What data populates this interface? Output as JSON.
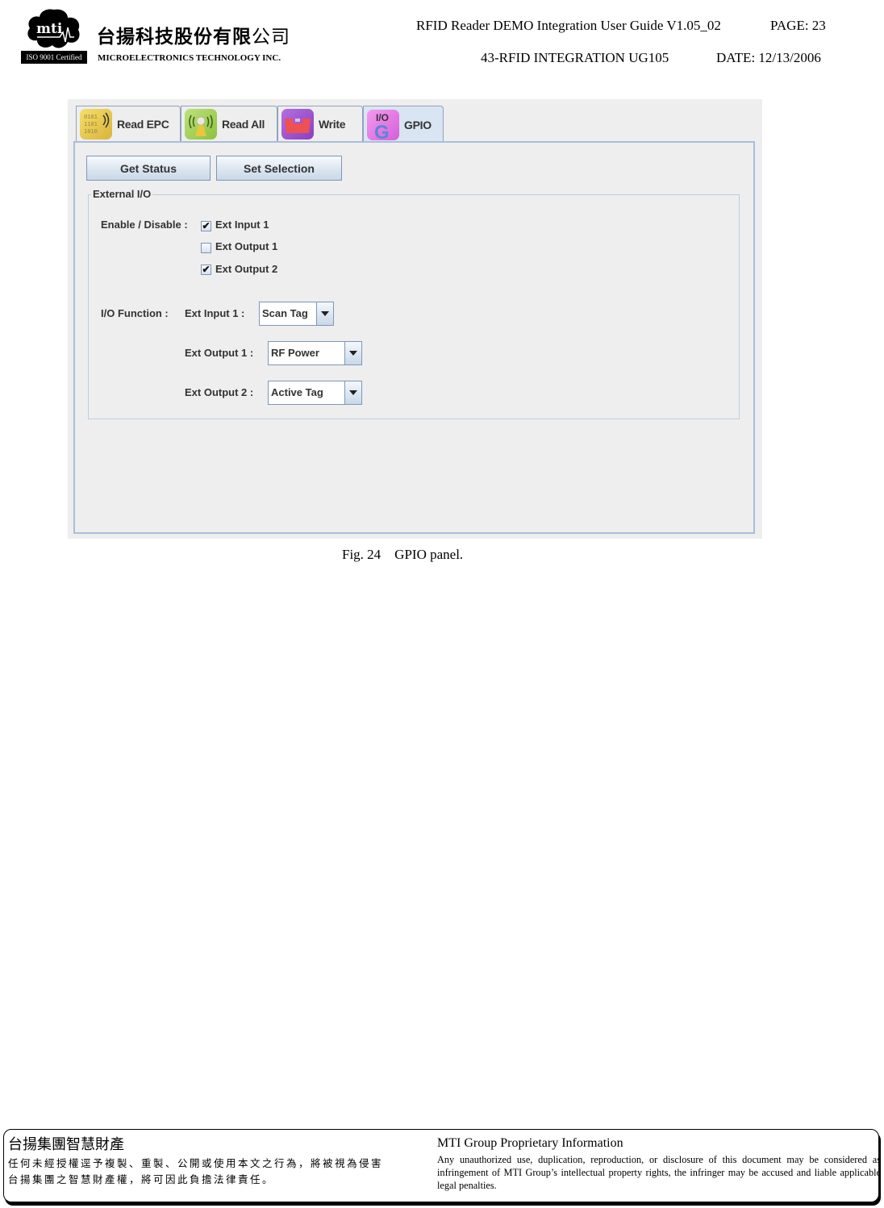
{
  "header": {
    "logo_text": "mti",
    "iso_badge": "ISO 9001 Certified",
    "company_cn_bold": "台揚科技股份有限",
    "company_cn_light": "公司",
    "company_en": "MICROELECTRONICS TECHNOLOGY INC.",
    "doc_title": "RFID Reader DEMO Integration User Guide V1.05_02",
    "page": "PAGE: 23",
    "doc_number": "43-RFID INTEGRATION UG105",
    "date": "DATE: 12/13/2006"
  },
  "app": {
    "tabs": [
      {
        "label": "Read EPC",
        "icon": "read-epc-icon",
        "active": false
      },
      {
        "label": "Read All",
        "icon": "read-all-icon",
        "active": false
      },
      {
        "label": "Write",
        "icon": "write-icon",
        "active": false
      },
      {
        "label": "GPIO",
        "icon": "gpio-icon",
        "active": true
      }
    ],
    "icon_texts": {
      "read_epc": "0101\n1101\n1010",
      "gpio_top": "I/O",
      "gpio_letter": "G"
    },
    "buttons": {
      "get_status": "Get Status",
      "set_selection": "Set Selection"
    },
    "group_title": "External I/O",
    "enable_label": "Enable / Disable :",
    "checkboxes": [
      {
        "label": "Ext Input 1",
        "checked": true
      },
      {
        "label": "Ext Output 1",
        "checked": false
      },
      {
        "label": "Ext Output 2",
        "checked": true
      }
    ],
    "check_mark": "✔",
    "function_label": "I/O Function :",
    "functions": [
      {
        "label": "Ext Input 1 :",
        "value": "Scan Tag"
      },
      {
        "label": "Ext Output 1 :",
        "value": "RF Power"
      },
      {
        "label": "Ext Output 2 :",
        "value": "Active Tag"
      }
    ]
  },
  "caption": "Fig. 24    GPIO panel.",
  "footer": {
    "cn_title": "台揚集團智慧財產",
    "cn_line1": "任何未經授權逕予複製、重製、公開或使用本文之行為，將被視為侵害",
    "cn_line2": "台揚集團之智慧財產權，將可因此負擔法律責任。",
    "en_title": "MTI Group Proprietary Information",
    "en_body": "Any unauthorized use, duplication, reproduction, or disclosure of this document may be considered as infringement of MTI Group’s intellectual property rights, the infringer may be accused and liable applicable legal penalties."
  }
}
